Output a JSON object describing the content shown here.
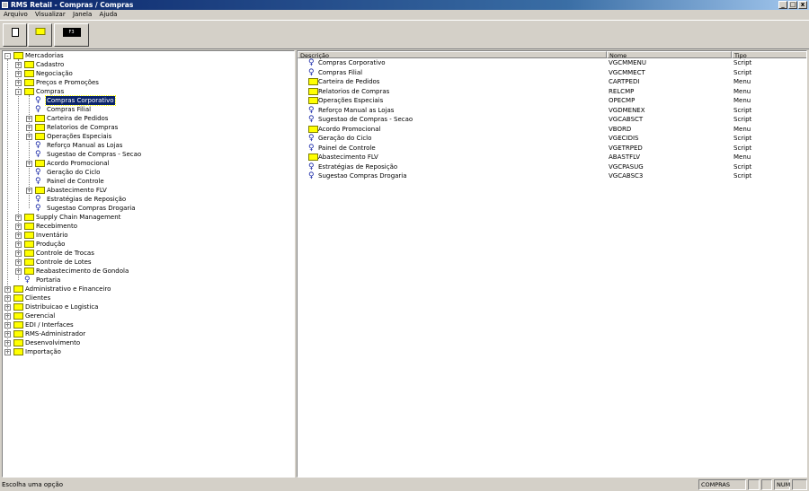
{
  "window": {
    "title": "RMS Retail - Compras / Compras",
    "min": "_",
    "max": "□",
    "close": "x"
  },
  "menu": [
    "Arquivo",
    "Visualizar",
    "Janela",
    "Ajuda"
  ],
  "toolbar": {
    "f3_label": "F3"
  },
  "tree": [
    {
      "label": "Mercadorias",
      "level": 0,
      "type": "folder",
      "expander": "-"
    },
    {
      "label": "Cadastro",
      "level": 1,
      "type": "folder",
      "expander": "+"
    },
    {
      "label": "Negociação",
      "level": 1,
      "type": "folder",
      "expander": "+"
    },
    {
      "label": "Preços e Promoções",
      "level": 1,
      "type": "folder",
      "expander": "+"
    },
    {
      "label": "Compras",
      "level": 1,
      "type": "folder",
      "expander": "-"
    },
    {
      "label": "Compras Corporativo",
      "level": 2,
      "type": "script",
      "expander": "",
      "selected": true
    },
    {
      "label": "Compras Filial",
      "level": 2,
      "type": "script",
      "expander": ""
    },
    {
      "label": "Carteira de Pedidos",
      "level": 2,
      "type": "folder",
      "expander": "+"
    },
    {
      "label": "Relatorios de Compras",
      "level": 2,
      "type": "folder",
      "expander": "+"
    },
    {
      "label": "Operações Especiais",
      "level": 2,
      "type": "folder",
      "expander": "+"
    },
    {
      "label": "Reforço Manual as Lojas",
      "level": 2,
      "type": "script",
      "expander": ""
    },
    {
      "label": "Sugestao de Compras - Secao",
      "level": 2,
      "type": "script",
      "expander": ""
    },
    {
      "label": "Acordo Promocional",
      "level": 2,
      "type": "folder",
      "expander": "+"
    },
    {
      "label": "Geração do Ciclo",
      "level": 2,
      "type": "script",
      "expander": ""
    },
    {
      "label": "Painel de Controle",
      "level": 2,
      "type": "script",
      "expander": ""
    },
    {
      "label": "Abastecimento FLV",
      "level": 2,
      "type": "folder",
      "expander": "+"
    },
    {
      "label": "Estratégias de Reposição",
      "level": 2,
      "type": "script",
      "expander": ""
    },
    {
      "label": "Sugestao Compras Drogaria",
      "level": 2,
      "type": "script",
      "expander": ""
    },
    {
      "label": "Supply Chain Management",
      "level": 1,
      "type": "folder",
      "expander": "+"
    },
    {
      "label": "Recebimento",
      "level": 1,
      "type": "folder",
      "expander": "+"
    },
    {
      "label": "Inventário",
      "level": 1,
      "type": "folder",
      "expander": "+"
    },
    {
      "label": "Produção",
      "level": 1,
      "type": "folder",
      "expander": "+"
    },
    {
      "label": "Controle de Trocas",
      "level": 1,
      "type": "folder",
      "expander": "+"
    },
    {
      "label": "Controle de Lotes",
      "level": 1,
      "type": "folder",
      "expander": "+"
    },
    {
      "label": "Reabastecimento de Gondola",
      "level": 1,
      "type": "folder",
      "expander": "+"
    },
    {
      "label": "Portaria",
      "level": 1,
      "type": "script",
      "expander": ""
    },
    {
      "label": "Administrativo e Financeiro",
      "level": 0,
      "type": "folder",
      "expander": "+"
    },
    {
      "label": "Clientes",
      "level": 0,
      "type": "folder",
      "expander": "+"
    },
    {
      "label": "Distribuicao e Logistica",
      "level": 0,
      "type": "folder",
      "expander": "+"
    },
    {
      "label": "Gerencial",
      "level": 0,
      "type": "folder",
      "expander": "+"
    },
    {
      "label": "EDI / Interfaces",
      "level": 0,
      "type": "folder",
      "expander": "+"
    },
    {
      "label": "RMS-Administrador",
      "level": 0,
      "type": "folder",
      "expander": "+"
    },
    {
      "label": "Desenvolvimento",
      "level": 0,
      "type": "folder",
      "expander": "+"
    },
    {
      "label": "Importação",
      "level": 0,
      "type": "folder",
      "expander": "+"
    }
  ],
  "list": {
    "columns": [
      "Descrição",
      "Nome",
      "Tipo"
    ],
    "rows": [
      {
        "desc": "Compras Corporativo",
        "name": "VGCMMENU",
        "type": "Script",
        "icon": "script"
      },
      {
        "desc": "Compras Filial",
        "name": "VGCMMECT",
        "type": "Script",
        "icon": "script"
      },
      {
        "desc": "Carteira de Pedidos",
        "name": "CARTPEDI",
        "type": "Menu",
        "icon": "folder"
      },
      {
        "desc": "Relatorios de Compras",
        "name": "RELCMP",
        "type": "Menu",
        "icon": "folder"
      },
      {
        "desc": "Operações Especiais",
        "name": "OPECMP",
        "type": "Menu",
        "icon": "folder"
      },
      {
        "desc": "Reforço Manual as Lojas",
        "name": "VGDMENEX",
        "type": "Script",
        "icon": "script"
      },
      {
        "desc": "Sugestao de Compras - Secao",
        "name": "VGCABSCT",
        "type": "Script",
        "icon": "script"
      },
      {
        "desc": "Acordo Promocional",
        "name": "VBORD",
        "type": "Menu",
        "icon": "folder"
      },
      {
        "desc": "Geração do Ciclo",
        "name": "VGECIDIS",
        "type": "Script",
        "icon": "script"
      },
      {
        "desc": "Painel de Controle",
        "name": "VGETRPED",
        "type": "Script",
        "icon": "script"
      },
      {
        "desc": "Abastecimento FLV",
        "name": "ABASTFLV",
        "type": "Menu",
        "icon": "folder"
      },
      {
        "desc": "Estratégias de Reposição",
        "name": "VGCPASUG",
        "type": "Script",
        "icon": "script"
      },
      {
        "desc": "Sugestao Compras Drogaria",
        "name": "VGCABSC3",
        "type": "Script",
        "icon": "script"
      }
    ]
  },
  "status": {
    "message": "Escolha uma opção",
    "module": "COMPRAS",
    "num": "NUM"
  },
  "colors": {
    "selection": "#0a246a",
    "folder": "#ffff00",
    "titlebar": "#0a246a"
  }
}
